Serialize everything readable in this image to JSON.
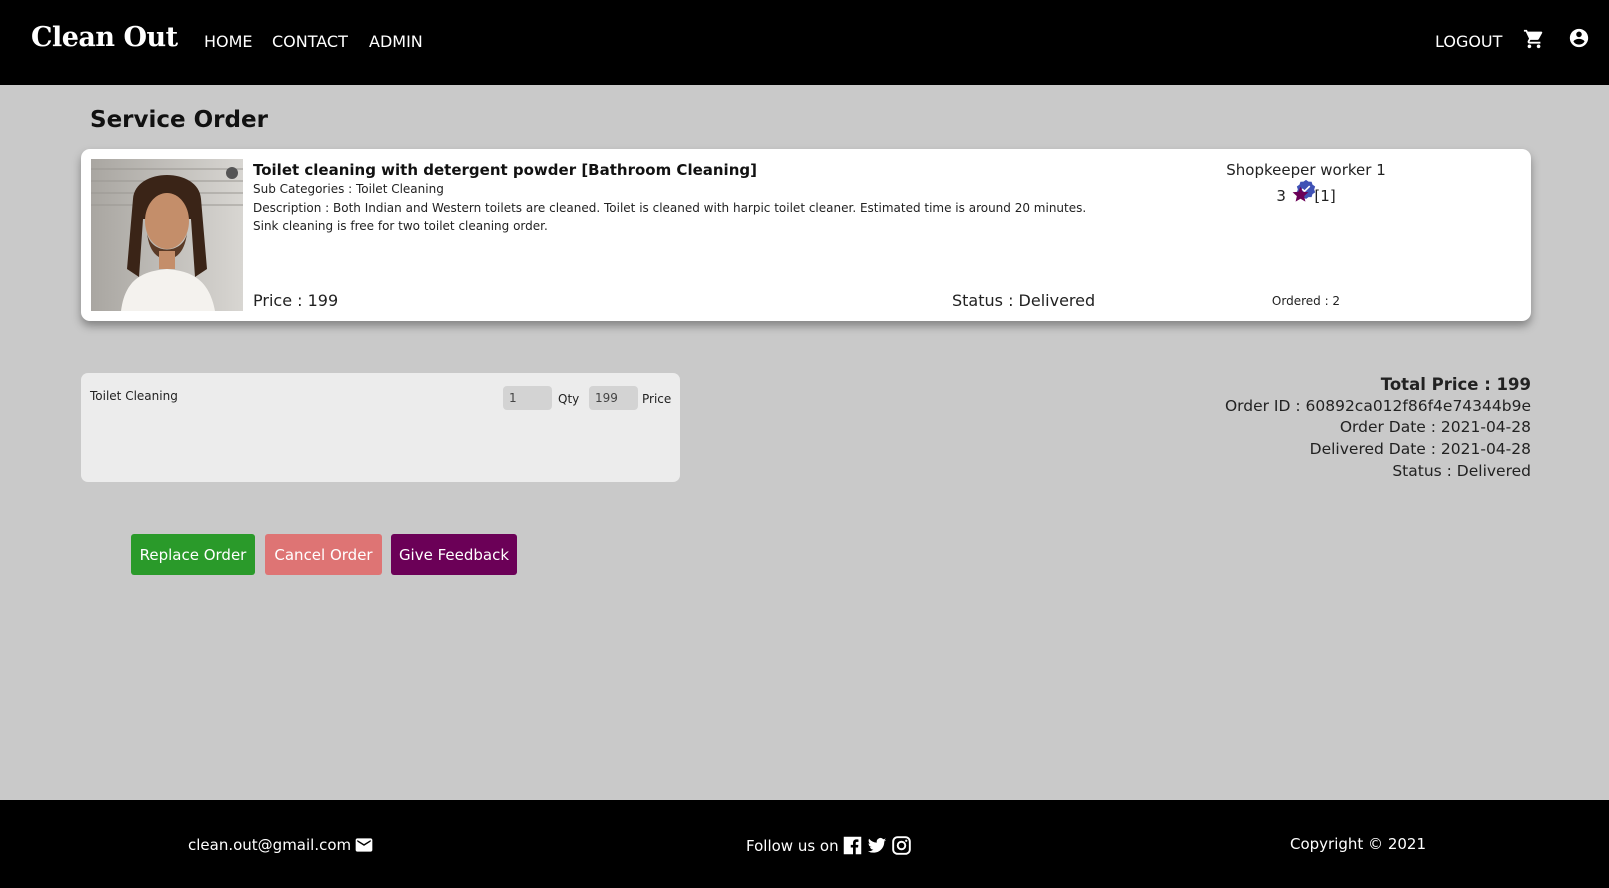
{
  "header": {
    "brand": "Clean Out",
    "nav": [
      {
        "label": "HOME"
      },
      {
        "label": "CONTACT"
      },
      {
        "label": "ADMIN"
      }
    ],
    "logout_label": "LOGOUT",
    "cart_icon": "cart-icon",
    "account_icon": "account-circle-icon"
  },
  "page": {
    "title": "Service Order"
  },
  "service": {
    "title": "Toilet cleaning with detergent powder [Bathroom Cleaning]",
    "sub_categories": "Sub Categories : Toilet Cleaning",
    "description": "Description : Both Indian and Western toilets are cleaned. Toilet is cleaned with harpic toilet cleaner. Estimated time is around 20 minutes. Sink cleaning is free for two toilet cleaning order.",
    "price": "Price : 199",
    "status": "Status : Delivered",
    "worker": "Shopkeeper worker 1",
    "verified_icon": "verified-badge-icon",
    "rating_value": "3",
    "rating_count": "[1]",
    "star_icon": "star-icon",
    "ordered": "Ordered : 2",
    "image": "worker-portrait-photo"
  },
  "item": {
    "name": "Toilet Cleaning",
    "qty_value": "1",
    "qty_label": "Qty",
    "price_value": "199",
    "price_label": "Price"
  },
  "summary": {
    "total": "Total Price : 199",
    "order_id": "Order ID : 60892ca012f86f4e74344b9e",
    "order_date": "Order Date : 2021-04-28",
    "delivered_date": "Delivered Date : 2021-04-28",
    "status": "Status : Delivered"
  },
  "actions": {
    "replace": "Replace Order",
    "cancel": "Cancel Order",
    "feedback": "Give Feedback"
  },
  "footer": {
    "email": "clean.out@gmail.com",
    "follow": "Follow us on",
    "copyright": "Copyright © 2021"
  },
  "colors": {
    "header_bg": "#000000",
    "page_bg": "#c9c9c9",
    "replace_btn": "#2a9a2a",
    "cancel_btn": "#de7474",
    "feedback_btn": "#6b0057",
    "star": "#6b0057",
    "verified": "#3f51b5"
  }
}
